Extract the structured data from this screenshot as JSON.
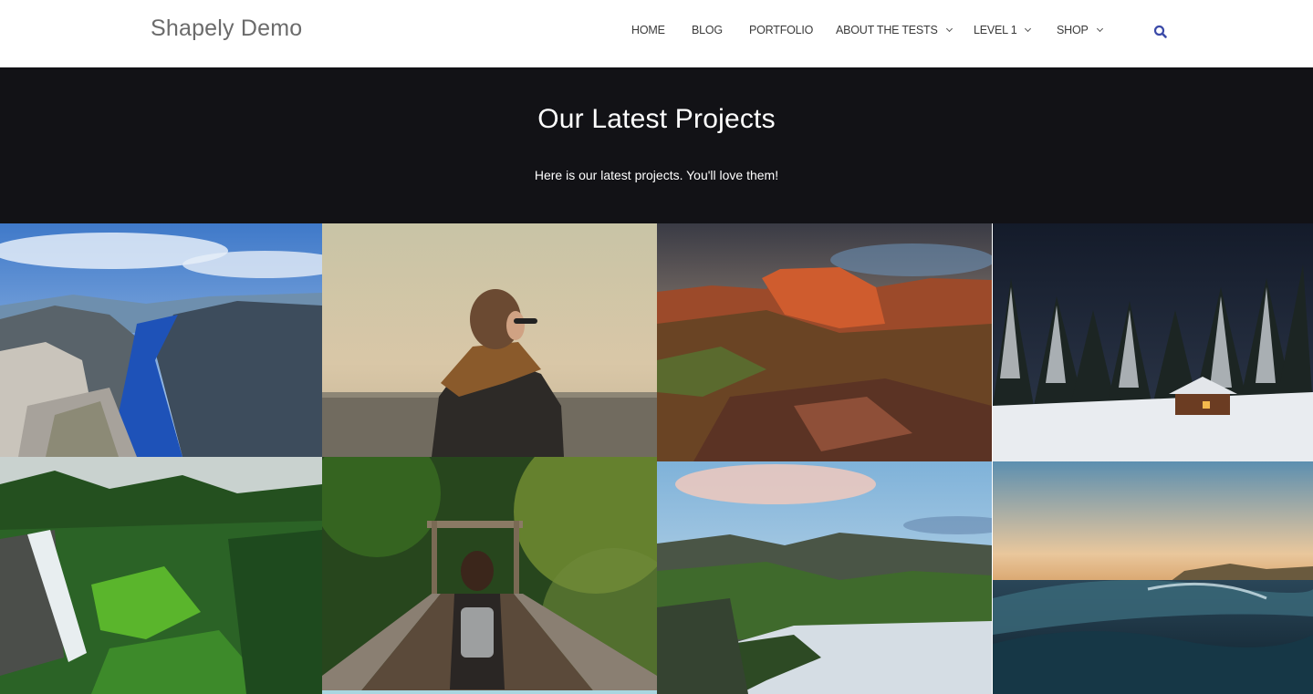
{
  "site": {
    "title": "Shapely Demo"
  },
  "nav": {
    "items": [
      {
        "label": "HOME",
        "dropdown": false
      },
      {
        "label": "BLOG",
        "dropdown": false
      },
      {
        "label": "PORTFOLIO",
        "dropdown": false
      },
      {
        "label": "ABOUT THE TESTS",
        "dropdown": true
      },
      {
        "label": "LEVEL 1",
        "dropdown": true
      },
      {
        "label": "SHOP",
        "dropdown": true
      }
    ],
    "search_icon": "search-icon",
    "accent": "#3b4aa8"
  },
  "hero": {
    "title": "Our Latest Projects",
    "subtitle": "Here is our latest projects. You'll love them!",
    "background": "#121216"
  },
  "portfolio": {
    "items": [
      {
        "image": "fjord-landscape-photo"
      },
      {
        "image": "person-with-scarf-photo"
      },
      {
        "image": "red-rock-canyon-photo"
      },
      {
        "image": "snowy-cabin-night-photo"
      },
      {
        "image": "forest-waterfall-photo"
      },
      {
        "image": "rope-bridge-hiker-photo"
      },
      {
        "image": "mountain-lake-photo"
      },
      {
        "image": "ocean-wave-sunset-photo"
      }
    ]
  }
}
